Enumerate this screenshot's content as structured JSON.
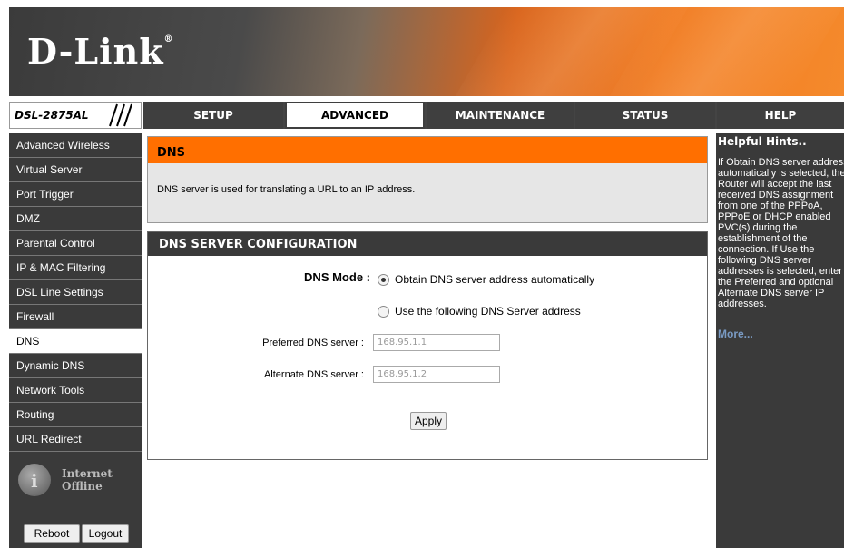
{
  "brand": {
    "logo": "D-Link",
    "model": "DSL-2875AL"
  },
  "tabs": [
    {
      "label": "SETUP",
      "active": false
    },
    {
      "label": "ADVANCED",
      "active": true
    },
    {
      "label": "MAINTENANCE",
      "active": false
    },
    {
      "label": "STATUS",
      "active": false
    },
    {
      "label": "HELP",
      "active": false
    }
  ],
  "sidebar": {
    "items": [
      {
        "label": "Advanced Wireless"
      },
      {
        "label": "Virtual Server"
      },
      {
        "label": "Port Trigger"
      },
      {
        "label": "DMZ"
      },
      {
        "label": "Parental Control"
      },
      {
        "label": "IP & MAC Filtering"
      },
      {
        "label": "DSL Line Settings"
      },
      {
        "label": "Firewall"
      },
      {
        "label": "DNS",
        "active": true
      },
      {
        "label": "Dynamic DNS"
      },
      {
        "label": "Network Tools"
      },
      {
        "label": "Routing"
      },
      {
        "label": "URL Redirect"
      }
    ],
    "internet_status": {
      "line1": "Internet",
      "line2": "Offline"
    },
    "reboot_label": "Reboot",
    "logout_label": "Logout"
  },
  "dns_section": {
    "title": "DNS",
    "description": "DNS server is used for translating a URL to an IP address."
  },
  "config": {
    "title": "DNS SERVER CONFIGURATION",
    "mode_label": "DNS Mode :",
    "option_auto": "Obtain DNS server address automatically",
    "option_manual": "Use the following DNS Server address",
    "selected": "auto",
    "preferred_label": "Preferred DNS server :",
    "preferred_value": "168.95.1.1",
    "alternate_label": "Alternate DNS server :",
    "alternate_value": "168.95.1.2",
    "apply_label": "Apply"
  },
  "help": {
    "title": "Helpful Hints..",
    "body": "If Obtain DNS server address automatically is selected, the Router will accept the last received DNS assignment from one of the PPPoA, PPPoE or DHCP enabled PVC(s) during the establishment of the connection. If Use the following DNS server addresses is selected, enter the Preferred and optional Alternate DNS server IP addresses.",
    "more": "More..."
  },
  "colors": {
    "accent": "#ff6f00",
    "dark": "#3a3a3a"
  }
}
